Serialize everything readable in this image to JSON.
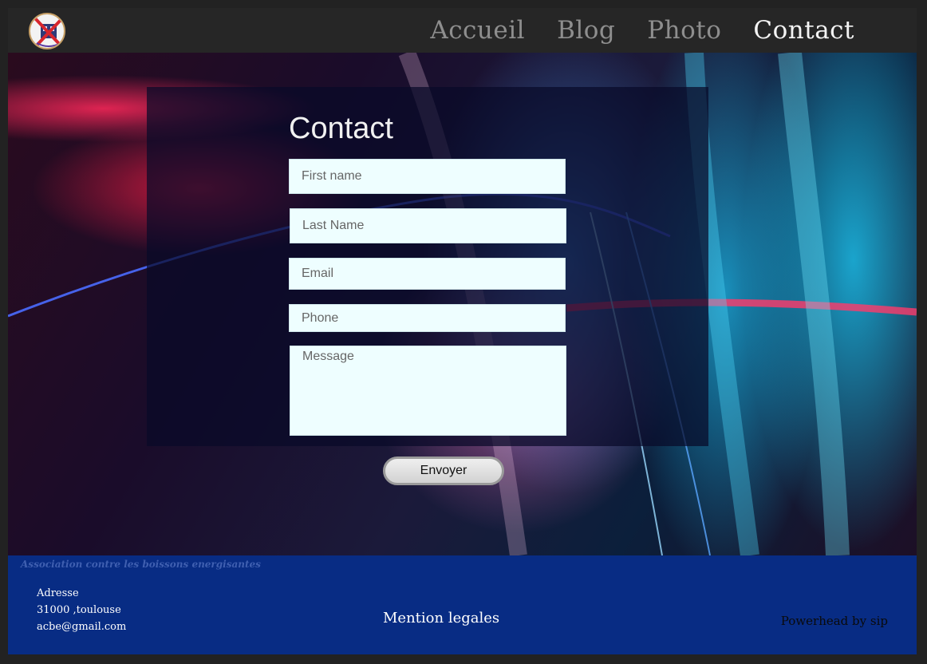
{
  "nav": {
    "items": [
      {
        "label": "Accueil",
        "active": false
      },
      {
        "label": "Blog",
        "active": false
      },
      {
        "label": "Photo",
        "active": false
      },
      {
        "label": "Contact",
        "active": true
      }
    ]
  },
  "form": {
    "title": "Contact",
    "first_name_placeholder": "First name",
    "last_name_placeholder": "Last Name",
    "email_placeholder": "Email",
    "phone_placeholder": "Phone",
    "message_placeholder": "Message",
    "submit_label": "Envoyer"
  },
  "footer": {
    "association": "Association contre les boissons energisantes",
    "address_label": "Adresse",
    "city": "31000 ,toulouse",
    "email": "acbe@gmail.com",
    "mention": "Mention legales",
    "powered": "Powerhead by sip"
  },
  "colors": {
    "nav_active": "#f4f4f4",
    "nav_inactive": "#8e8e8e",
    "footer_bg": "#052d8c",
    "field_bg": "#eefeff"
  },
  "icons": {
    "logo": "no-energy-drink-logo"
  }
}
